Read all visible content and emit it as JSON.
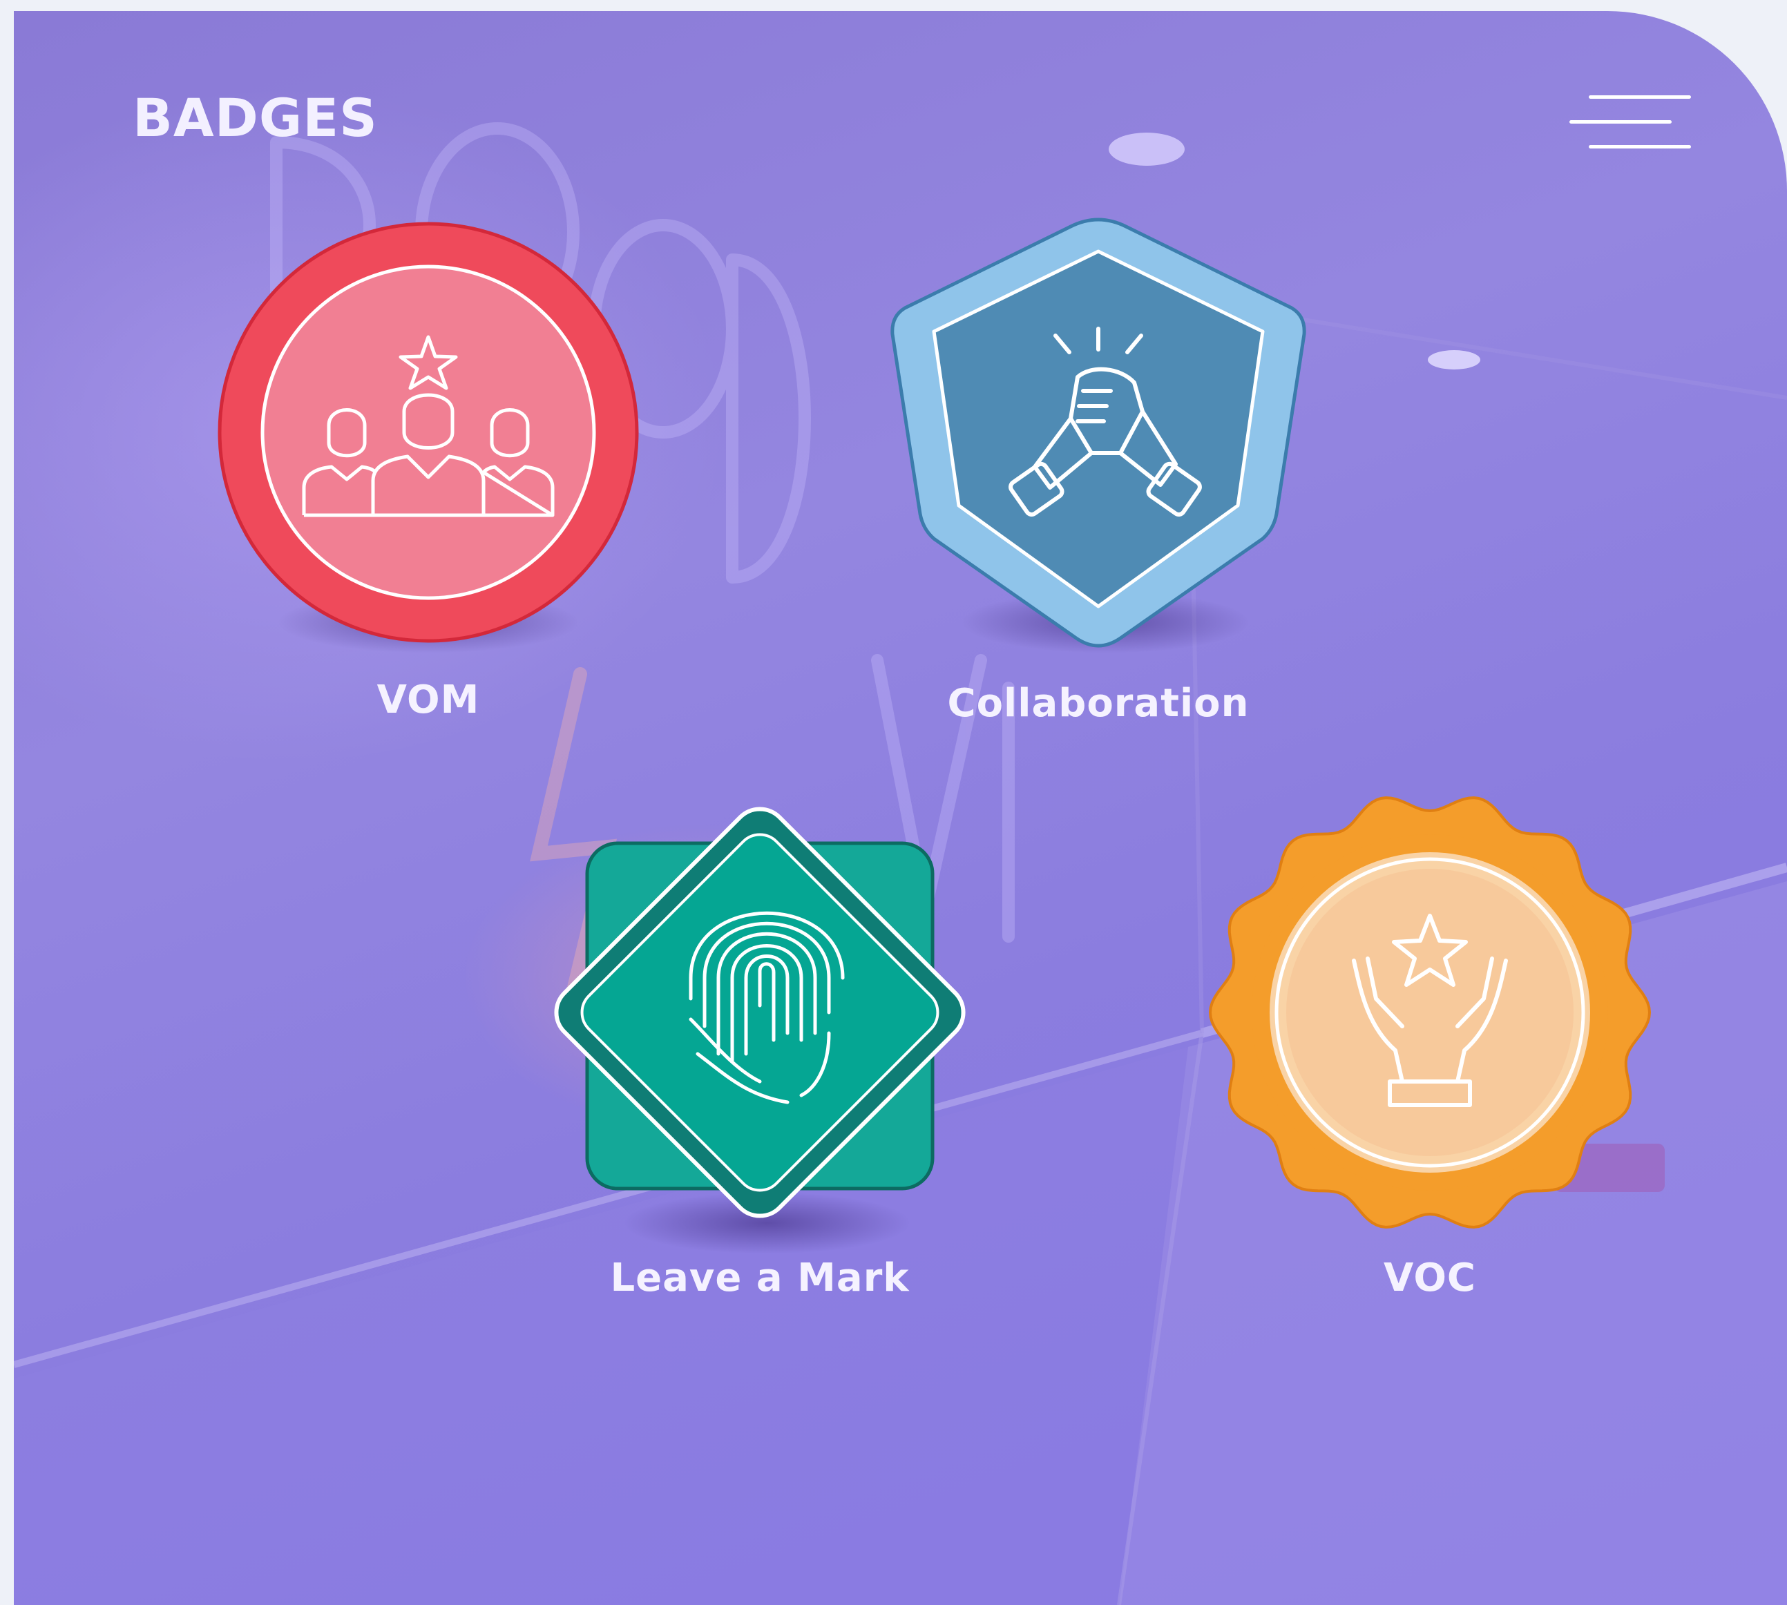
{
  "header": {
    "title": "BADGES",
    "menu_icon": "hamburger-menu-icon"
  },
  "badges": [
    {
      "label": "VOM",
      "icon": "team-star-icon",
      "shape": "circle",
      "color": "#ef4a5b",
      "inner_color": "#f17f93"
    },
    {
      "label": "Collaboration",
      "icon": "handshake-icon",
      "shape": "hexagon-shield",
      "color": "#8fc4ea",
      "inner_color": "#4f8bb4"
    },
    {
      "label": "Leave a Mark",
      "icon": "fingerprint-icon",
      "shape": "diamond",
      "color": "#14a898",
      "inner_color": "#05a693"
    },
    {
      "label": "VOC",
      "icon": "hands-star-icon",
      "shape": "scalloped-seal",
      "color": "#f49d2b",
      "inner_color": "#f7c99b"
    }
  ],
  "background_image": "neon-sign-room-photo"
}
